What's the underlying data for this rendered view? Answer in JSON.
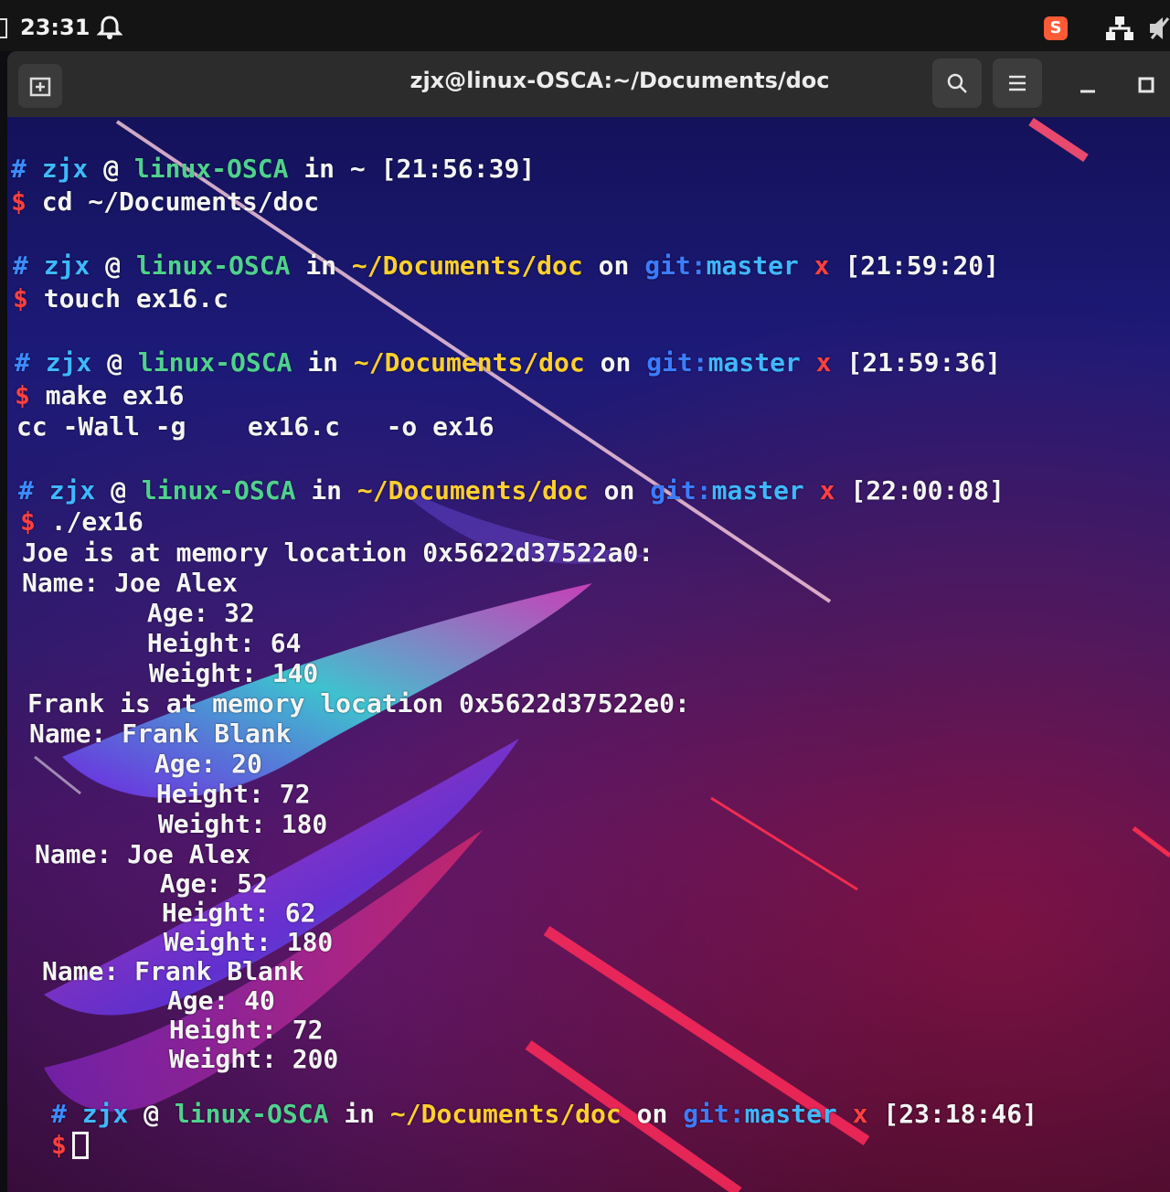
{
  "system_bar": {
    "time": "23:31"
  },
  "window": {
    "title": "zjx@linux-OSCA:~/Documents/doc"
  },
  "prompts": [
    {
      "user": "zjx",
      "at": "@",
      "host": "linux-OSCA",
      "in": "in",
      "path": "~",
      "on": "",
      "git": "",
      "branch": "",
      "dirty": "",
      "time": "[21:56:39]",
      "command": "cd ~/Documents/doc"
    },
    {
      "user": "zjx",
      "at": "@",
      "host": "linux-OSCA",
      "in": "in",
      "path": "~/Documents/doc",
      "on": "on",
      "git": "git:",
      "branch": "master",
      "dirty": "x",
      "time": "[21:59:20]",
      "command": "touch ex16.c"
    },
    {
      "user": "zjx",
      "at": "@",
      "host": "linux-OSCA",
      "in": "in",
      "path": "~/Documents/doc",
      "on": "on",
      "git": "git:",
      "branch": "master",
      "dirty": "x",
      "time": "[21:59:36]",
      "command": "make ex16"
    },
    {
      "user": "zjx",
      "at": "@",
      "host": "linux-OSCA",
      "in": "in",
      "path": "~/Documents/doc",
      "on": "on",
      "git": "git:",
      "branch": "master",
      "dirty": "x",
      "time": "[22:00:08]",
      "command": "./ex16"
    },
    {
      "user": "zjx",
      "at": "@",
      "host": "linux-OSCA",
      "in": "in",
      "path": "~/Documents/doc",
      "on": "on",
      "git": "git:",
      "branch": "master",
      "dirty": "x",
      "time": "[23:18:46]",
      "command": ""
    }
  ],
  "prompt_symbols": {
    "hash": "#",
    "dollar": "$"
  },
  "output": {
    "make": "cc -Wall -g    ex16.c   -o ex16",
    "run": [
      "Joe is at memory location 0x5622d37522a0:",
      "Name: Joe Alex",
      "        Age: 32",
      "        Height: 64",
      "        Weight: 140",
      "Frank is at memory location 0x5622d37522e0:",
      "Name: Frank Blank",
      "        Age: 20",
      "        Height: 72",
      "        Weight: 180",
      "Name: Joe Alex",
      "        Age: 52",
      "        Height: 62",
      "        Weight: 180",
      "Name: Frank Blank",
      "        Age: 40",
      "        Height: 72",
      "        Weight: 200"
    ]
  },
  "icons": [
    "bell-icon",
    "new-tab-icon",
    "search-icon",
    "hamburger-menu-icon",
    "minimize-icon",
    "maximize-icon",
    "network-icon",
    "app-tray-icon"
  ]
}
